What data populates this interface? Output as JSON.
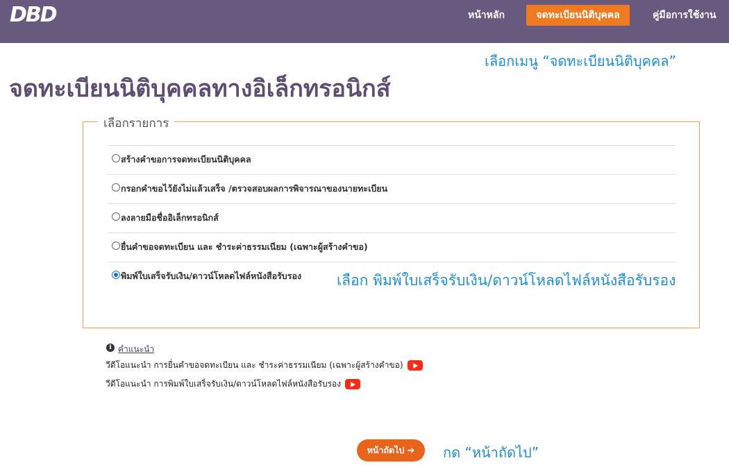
{
  "nav": {
    "logo": "DBD",
    "home": "หน้าหลัก",
    "register": "จดทะเบียนนิติบุคคล",
    "guide": "คู่มือการใช้งาน"
  },
  "annotations": {
    "top": "เลือกเมนู  “จดทะเบียนนิติบุคคล”",
    "select": "เลือก พิมพ์ใบเสร็จรับเงิน/ดาวน์โหลดไฟล์หนังสือรับรอง",
    "next": "กด “หน้าถัดไป”"
  },
  "page": {
    "title": "จดทะเบียนนิติบุคคลทางอิเล็กทรอนิกส์"
  },
  "form": {
    "legend": "เลือกรายการ",
    "options": [
      {
        "label": "สร้างคำขอการจดทะเบียนนิติบุคคล",
        "checked": false
      },
      {
        "label": "กรอกคำขอไว้ยังไม่แล้วเสร็จ /ตรวจสอบผลการพิจารณาของนายทะเบียน",
        "checked": false
      },
      {
        "label": "ลงลายมือชื่ออิเล็กทรอนิกส์",
        "checked": false
      },
      {
        "label": "ยื่นคำขอจดทะเบียน และ ชำระค่าธรรมเนียม (เฉพาะผู้สร้างคำขอ)",
        "checked": false
      },
      {
        "label": "พิมพ์ใบเสร็จรับเงิน/ดาวน์โหลดไฟล์หนังสือรับรอง",
        "checked": true
      }
    ]
  },
  "help": {
    "icon": "info-icon",
    "link": "คำแนะนำ",
    "videos": [
      "วีดีโอแนะนำ การยื่นคำขอจดทะเบียน และ ชำระค่าธรรมเนียม (เฉพาะผู้สร้างคำขอ)",
      "วีดีโอแนะนำ การพิมพ์ใบเสร็จรับเงิน/ดาวน์โหลดไฟล์หนังสือรับรอง"
    ]
  },
  "next_button": {
    "label": "หน้าถัดไป",
    "arrow": "➔"
  },
  "colors": {
    "navbar": "#685a7f",
    "accent_orange": "#f07a1f",
    "annotation_blue": "#1f8fd6",
    "title_purple": "#5b4e72"
  }
}
